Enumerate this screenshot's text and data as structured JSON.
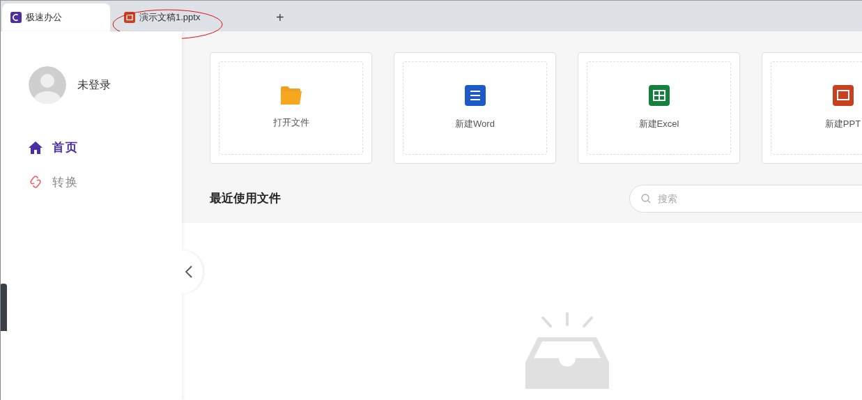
{
  "tabs": [
    {
      "label": "极速办公",
      "kind": "app",
      "selected": true
    },
    {
      "label": "演示文稿1.pptx",
      "kind": "ppt",
      "selected": false
    }
  ],
  "new_tab": "+",
  "sidebar": {
    "user": "未登录",
    "items": [
      {
        "label": "首页",
        "kind": "home",
        "selected": true
      },
      {
        "label": "转换",
        "kind": "convert",
        "selected": false
      }
    ]
  },
  "actions": [
    {
      "label": "打开文件",
      "kind": "open"
    },
    {
      "label": "新建Word",
      "kind": "word"
    },
    {
      "label": "新建Excel",
      "kind": "excel"
    },
    {
      "label": "新建PPT",
      "kind": "ppt"
    }
  ],
  "recent": {
    "title": "最近使用文件",
    "search": {
      "placeholder": "搜索"
    }
  }
}
